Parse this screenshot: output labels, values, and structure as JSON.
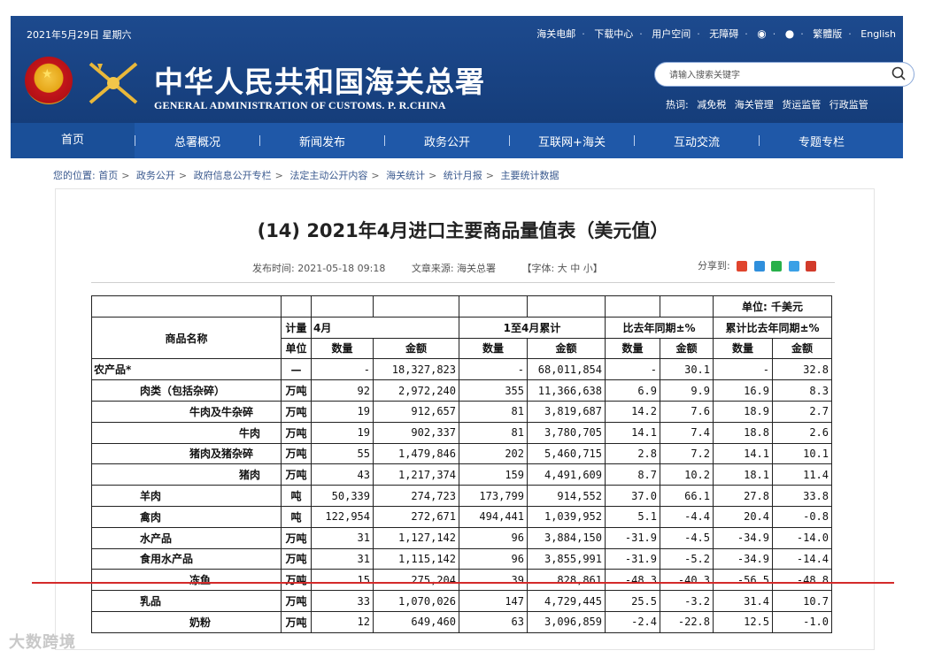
{
  "header": {
    "date": "2021年5月29日 星期六",
    "top_links": [
      "海关电邮",
      "下载中心",
      "用户空间",
      "无障碍"
    ],
    "top_links_tail": [
      "繁體版",
      "English"
    ],
    "title_cn": "中华人民共和国海关总署",
    "title_en": "GENERAL ADMINISTRATION OF CUSTOMS. P. R.CHINA",
    "search_placeholder": "请输入搜索关键字",
    "hot_label": "热词:",
    "hot_words": [
      "减免税",
      "海关管理",
      "货运监管",
      "行政监管"
    ],
    "icons": [
      "weibo-icon",
      "wechat-icon",
      "search-icon"
    ]
  },
  "nav": {
    "items": [
      "首页",
      "总署概况",
      "新闻发布",
      "政务公开",
      "互联网+海关",
      "互动交流",
      "专题专栏"
    ],
    "active_index": 0
  },
  "breadcrumb": [
    "您的位置: 首页",
    "政务公开",
    "政府信息公开专栏",
    "法定主动公开内容",
    "海关统计",
    "统计月报",
    "主要统计数据"
  ],
  "article": {
    "title": "(14) 2021年4月进口主要商品量值表（美元值）",
    "publish_time": "发布时间: 2021-05-18 09:18",
    "source": "文章来源: 海关总署",
    "font_size": "【字体: 大 中 小】",
    "share_label": "分享到:"
  },
  "table": {
    "unit_note": "单位: 千美元",
    "col_name": "商品名称",
    "col_unit_1": "计量",
    "col_unit_2": "单位",
    "group_month": "4月",
    "group_ytd": "1至4月累计",
    "group_yoy": "比去年同期±%",
    "group_ytd_yoy": "累计比去年同期±%",
    "sub_qty": "数量",
    "sub_amt": "金额",
    "rows": [
      {
        "name": "农产品*",
        "indent": 0,
        "unit": "—",
        "q": "-",
        "a": "18,327,823",
        "yq": "-",
        "ya": "68,011,854",
        "pq": "-",
        "pa": "30.1",
        "cq": "-",
        "ca": "32.8"
      },
      {
        "name": "肉类（包括杂碎）",
        "indent": 1,
        "unit": "万吨",
        "q": "92",
        "a": "2,972,240",
        "yq": "355",
        "ya": "11,366,638",
        "pq": "6.9",
        "pa": "9.9",
        "cq": "16.9",
        "ca": "8.3"
      },
      {
        "name": "牛肉及牛杂碎",
        "indent": 2,
        "unit": "万吨",
        "q": "19",
        "a": "912,657",
        "yq": "81",
        "ya": "3,819,687",
        "pq": "14.2",
        "pa": "7.6",
        "cq": "18.9",
        "ca": "2.7"
      },
      {
        "name": "牛肉",
        "indent": 3,
        "unit": "万吨",
        "q": "19",
        "a": "902,337",
        "yq": "81",
        "ya": "3,780,705",
        "pq": "14.1",
        "pa": "7.4",
        "cq": "18.8",
        "ca": "2.6"
      },
      {
        "name": "猪肉及猪杂碎",
        "indent": 2,
        "unit": "万吨",
        "q": "55",
        "a": "1,479,846",
        "yq": "202",
        "ya": "5,460,715",
        "pq": "2.8",
        "pa": "7.2",
        "cq": "14.1",
        "ca": "10.1"
      },
      {
        "name": "猪肉",
        "indent": 3,
        "unit": "万吨",
        "q": "43",
        "a": "1,217,374",
        "yq": "159",
        "ya": "4,491,609",
        "pq": "8.7",
        "pa": "10.2",
        "cq": "18.1",
        "ca": "11.4"
      },
      {
        "name": "羊肉",
        "indent": 1,
        "unit": "吨",
        "q": "50,339",
        "a": "274,723",
        "yq": "173,799",
        "ya": "914,552",
        "pq": "37.0",
        "pa": "66.1",
        "cq": "27.8",
        "ca": "33.8"
      },
      {
        "name": "禽肉",
        "indent": 1,
        "unit": "吨",
        "q": "122,954",
        "a": "272,671",
        "yq": "494,441",
        "ya": "1,039,952",
        "pq": "5.1",
        "pa": "-4.4",
        "cq": "20.4",
        "ca": "-0.8"
      },
      {
        "name": "水产品",
        "indent": 1,
        "unit": "万吨",
        "q": "31",
        "a": "1,127,142",
        "yq": "96",
        "ya": "3,884,150",
        "pq": "-31.9",
        "pa": "-4.5",
        "cq": "-34.9",
        "ca": "-14.0"
      },
      {
        "name": "食用水产品",
        "indent": 1,
        "unit": "万吨",
        "q": "31",
        "a": "1,115,142",
        "yq": "96",
        "ya": "3,855,991",
        "pq": "-31.9",
        "pa": "-5.2",
        "cq": "-34.9",
        "ca": "-14.4"
      },
      {
        "name": "冻鱼",
        "indent": 2,
        "unit": "万吨",
        "q": "15",
        "a": "275,204",
        "yq": "39",
        "ya": "828,861",
        "pq": "-48.3",
        "pa": "-40.3",
        "cq": "-56.5",
        "ca": "-48.8"
      },
      {
        "name": "乳品",
        "indent": 1,
        "unit": "万吨",
        "q": "33",
        "a": "1,070,026",
        "yq": "147",
        "ya": "4,729,445",
        "pq": "25.5",
        "pa": "-3.2",
        "cq": "31.4",
        "ca": "10.7"
      },
      {
        "name": "奶粉",
        "indent": 2,
        "unit": "万吨",
        "q": "12",
        "a": "649,460",
        "yq": "63",
        "ya": "3,096,859",
        "pq": "-2.4",
        "pa": "-22.8",
        "cq": "12.5",
        "ca": "-1.0"
      }
    ]
  },
  "watermark": "大数跨境"
}
